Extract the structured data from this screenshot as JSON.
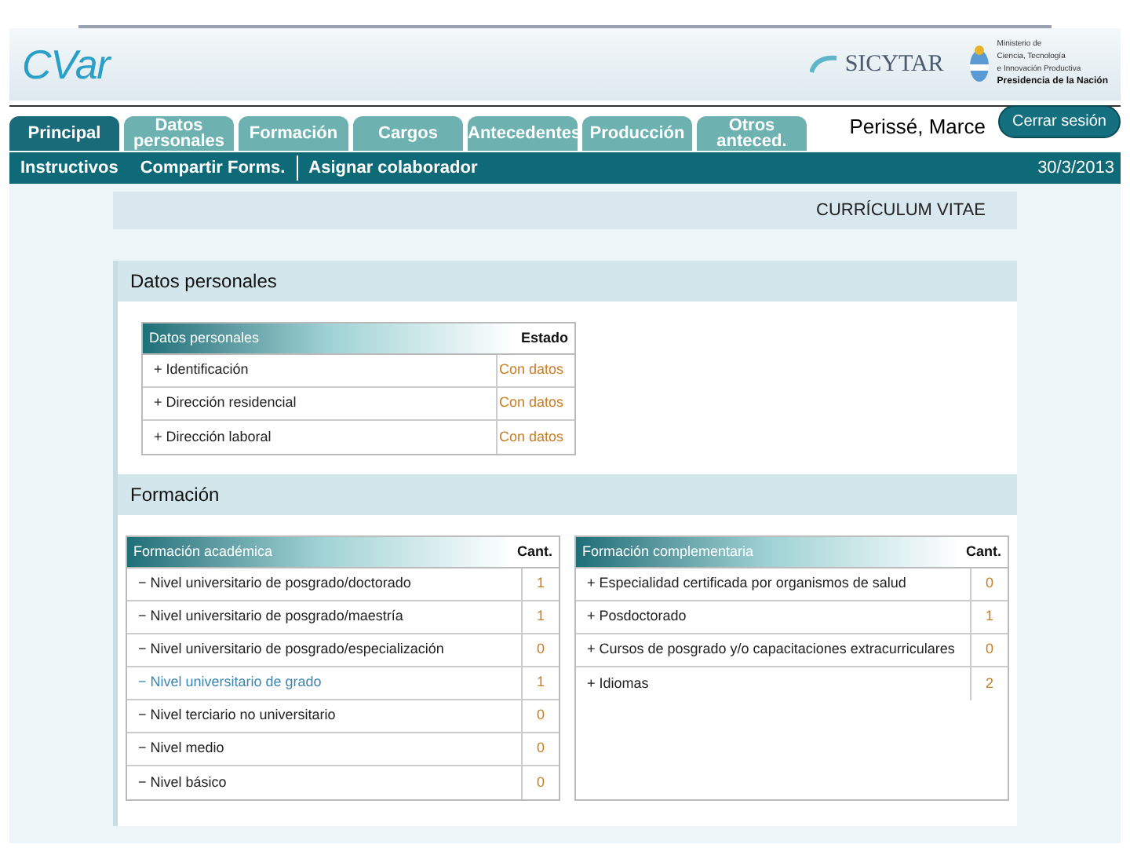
{
  "header": {
    "logo": "CVar",
    "brand": "SICYTAR",
    "ministry": [
      "Ministerio de",
      "Ciencia, Tecnología",
      "e Innovación Productiva",
      "Presidencia de la Nación"
    ]
  },
  "tabs": [
    {
      "label": "Principal",
      "selected": true
    },
    {
      "label": "Datos personales",
      "selected": false
    },
    {
      "label": "Formación",
      "selected": false
    },
    {
      "label": "Cargos",
      "selected": false
    },
    {
      "label": "Antecedentes",
      "selected": false
    },
    {
      "label": "Producción",
      "selected": false
    },
    {
      "label": "Otros anteced.",
      "selected": false
    }
  ],
  "user": {
    "name": "Perissé, Marce",
    "logout": "Cerrar sesión",
    "date": "30/3/2013"
  },
  "subnav": [
    "Instructivos",
    "Compartir Forms.",
    "Asignar colaborador"
  ],
  "page_title": "CURRÍCULUM VITAE",
  "sections": [
    {
      "title": "Datos personales",
      "tables": [
        {
          "heading": "Datos personales",
          "column": "Estado",
          "rows": [
            {
              "label": "+ Identificación",
              "value": "Con datos",
              "highlighted": false
            },
            {
              "label": "+ Dirección residencial",
              "value": "Con datos",
              "highlighted": false
            },
            {
              "label": "+ Dirección laboral",
              "value": "Con datos",
              "highlighted": false
            }
          ]
        }
      ]
    },
    {
      "title": "Formación",
      "tables": [
        {
          "heading": "Formación académica",
          "column": "Cant.",
          "rows": [
            {
              "label": "− Nivel universitario de posgrado/doctorado",
              "value": "1",
              "highlighted": false
            },
            {
              "label": "− Nivel universitario de posgrado/maestría",
              "value": "1",
              "highlighted": false
            },
            {
              "label": "− Nivel universitario de posgrado/especialización",
              "value": "0",
              "highlighted": false
            },
            {
              "label": "− Nivel universitario de grado",
              "value": "1",
              "highlighted": true
            },
            {
              "label": "− Nivel terciario no universitario",
              "value": "0",
              "highlighted": false
            },
            {
              "label": "− Nivel medio",
              "value": "0",
              "highlighted": false
            },
            {
              "label": "− Nivel básico",
              "value": "0",
              "highlighted": false
            }
          ]
        },
        {
          "heading": "Formación complementaria",
          "column": "Cant.",
          "rows": [
            {
              "label": "+ Especialidad certificada por organismos de salud",
              "value": "0",
              "highlighted": false
            },
            {
              "label": "+ Posdoctorado",
              "value": "1",
              "highlighted": false
            },
            {
              "label": "+ Cursos de posgrado y/o capacitaciones extracurriculares",
              "value": "0",
              "highlighted": false
            },
            {
              "label": "+ Idiomas",
              "value": "2",
              "highlighted": false
            }
          ]
        }
      ]
    }
  ]
}
